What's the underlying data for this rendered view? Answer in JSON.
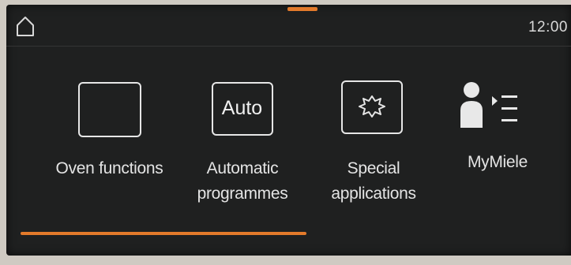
{
  "status_bar": {
    "time": "12:00"
  },
  "menu": {
    "items": [
      {
        "label": "Oven functions",
        "icon": "oven-frame-icon"
      },
      {
        "label": "Automatic programmes",
        "icon": "auto-icon",
        "icon_text": "Auto"
      },
      {
        "label": "Special applications",
        "icon": "special-applications-icon"
      },
      {
        "label": "MyMiele",
        "icon": "person-list-icon"
      }
    ]
  },
  "colors": {
    "accent": "#e37a2b",
    "screen_bg": "#1f2020",
    "text": "#e4e4e4"
  }
}
